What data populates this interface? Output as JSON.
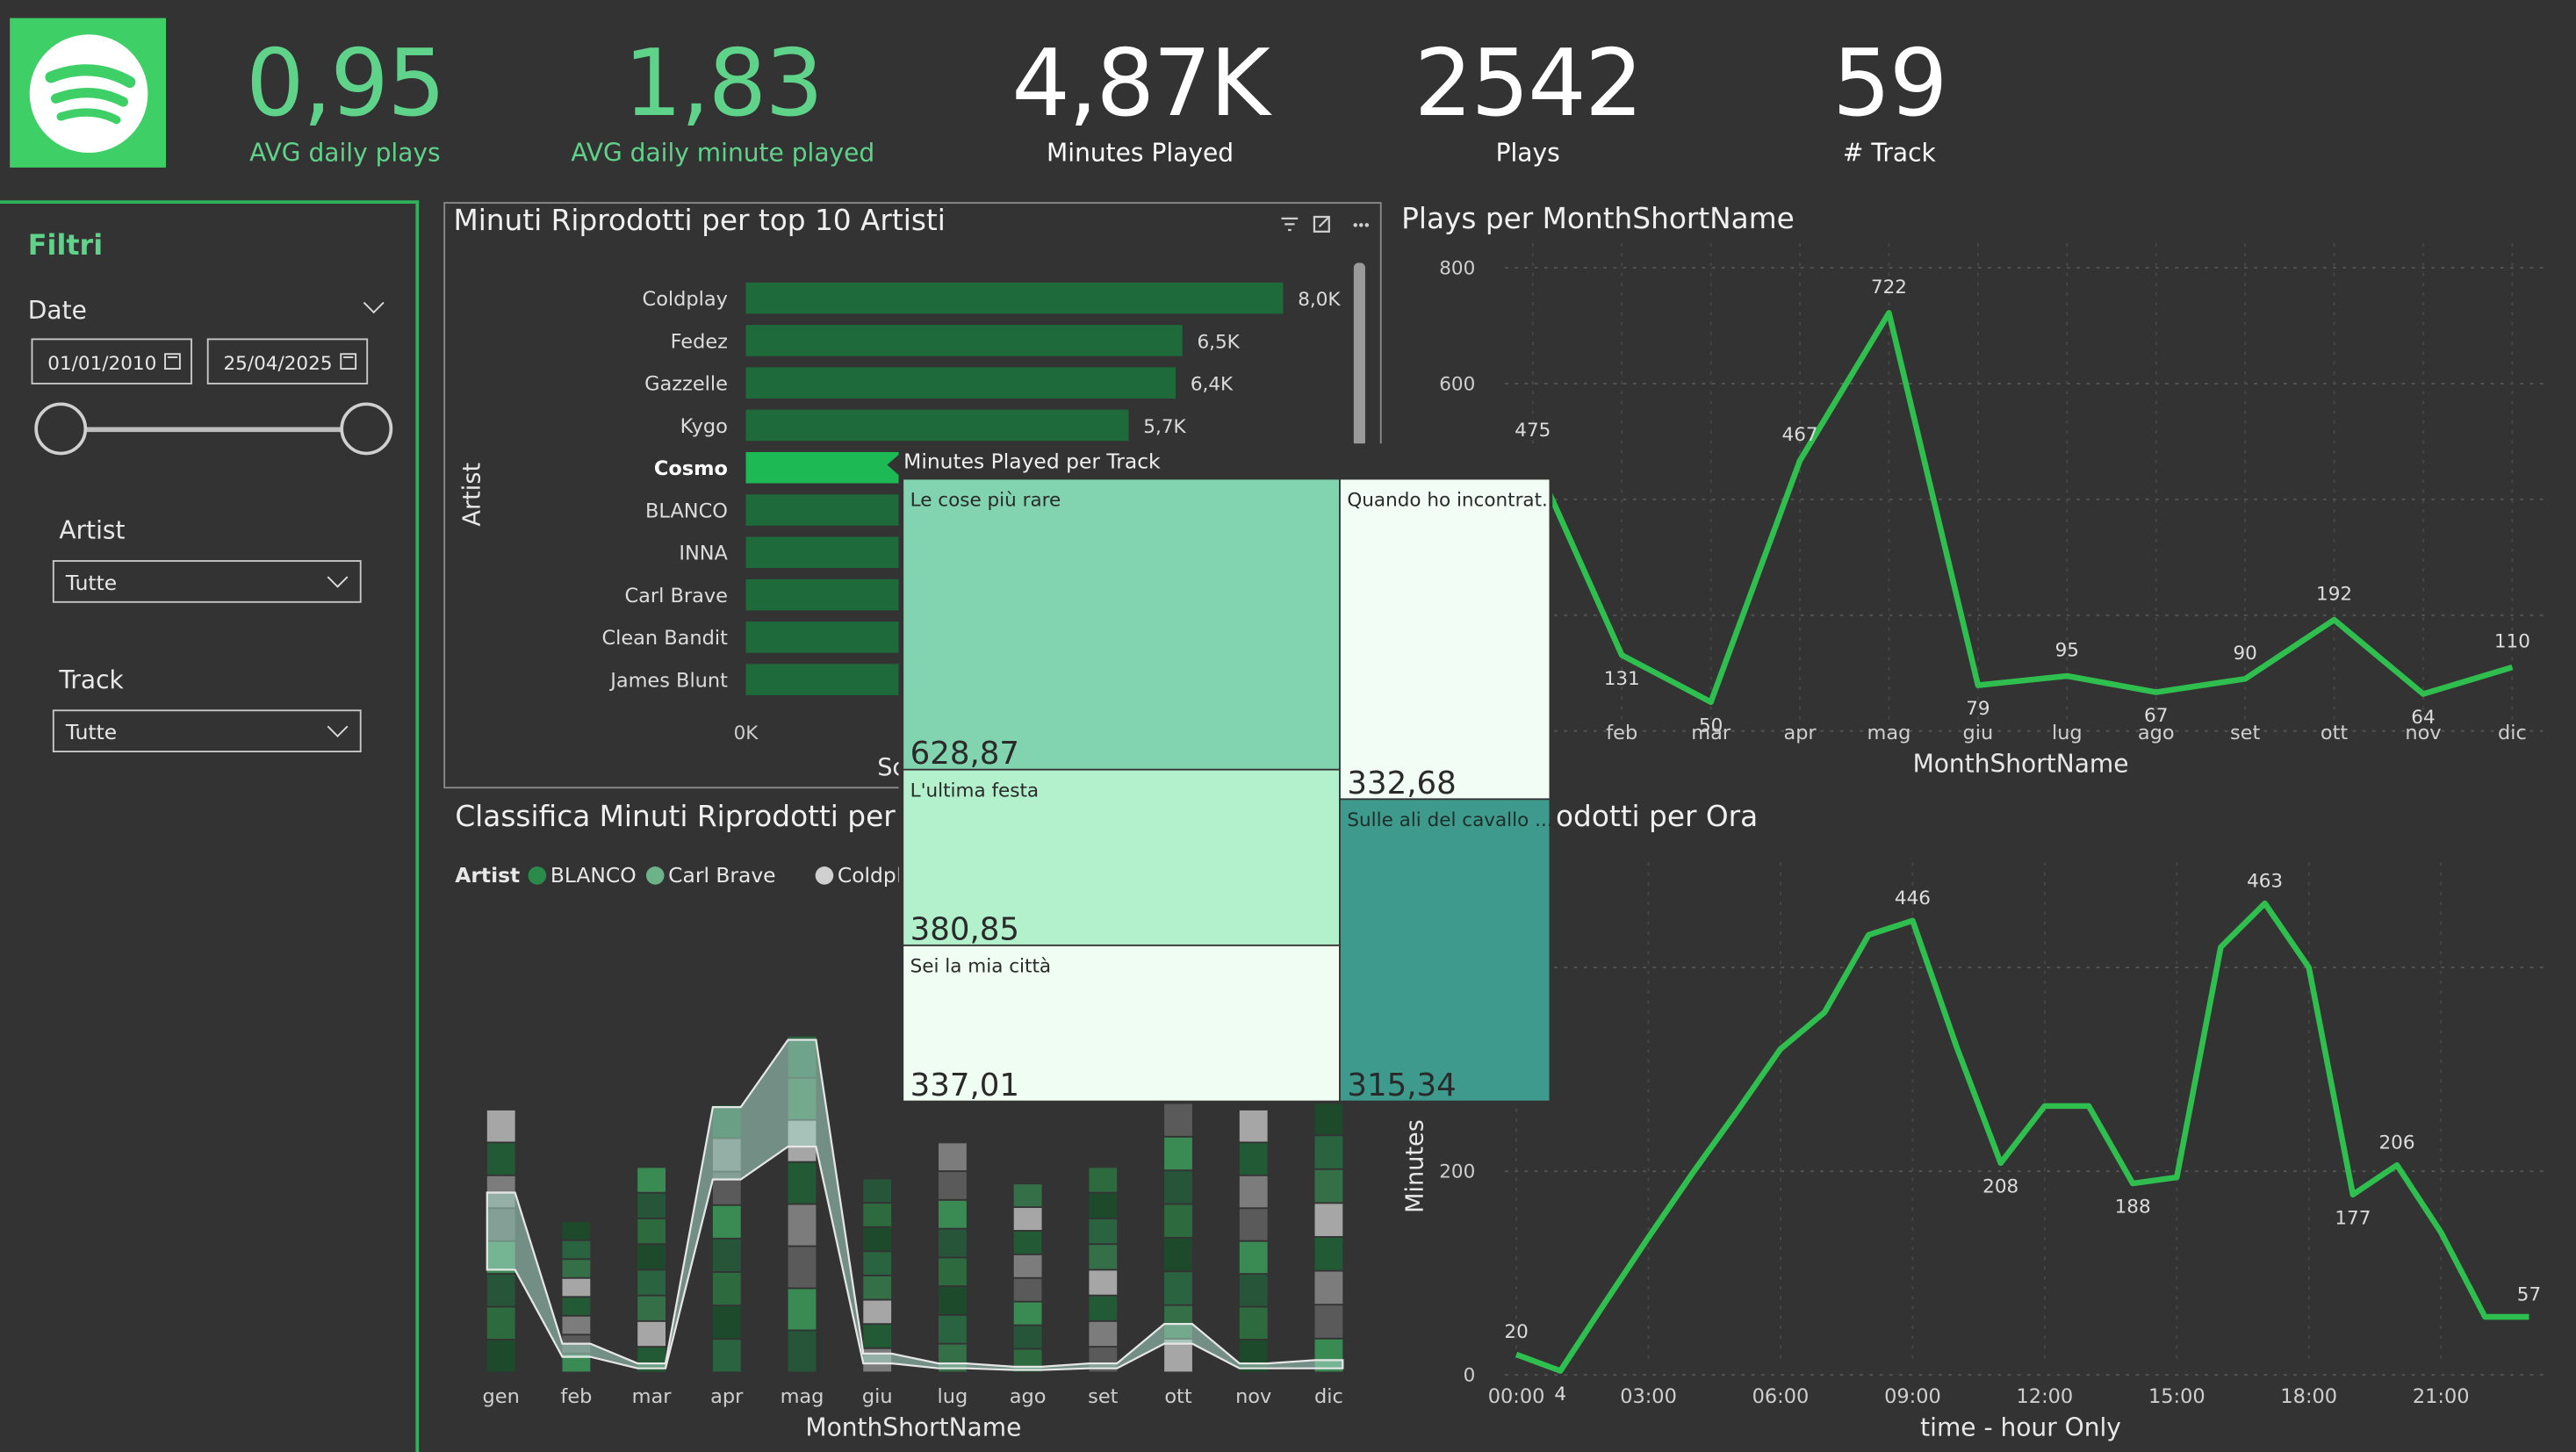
{
  "kpis": [
    {
      "value": "0,95",
      "label": "AVG daily plays"
    },
    {
      "value": "1,83",
      "label": "AVG daily minute played"
    },
    {
      "value": "4,87K",
      "label": "Minutes Played"
    },
    {
      "value": "2542",
      "label": "Plays"
    },
    {
      "value": "59",
      "label": "# Track"
    }
  ],
  "sidebar": {
    "title": "Filtri",
    "date_label": "Date",
    "date_from": "01/01/2010",
    "date_to": "25/04/2025",
    "date_range_fraction": [
      0,
      1
    ],
    "artist_label": "Artist",
    "artist_value": "Tutte",
    "track_label": "Track",
    "track_value": "Tutte"
  },
  "icons": {
    "logo": "spotify-logo",
    "filter": "filter-icon",
    "focus": "focus-mode-icon",
    "more": "more-options-icon",
    "calendar": "calendar-icon",
    "dropdown": "chevron-down-icon"
  },
  "colors": {
    "accent": "#2fb35a",
    "line": "#2fbf4f",
    "bar": "#1e6a3a",
    "bar_highlight": "#1db954",
    "background": "#333333"
  },
  "panels": {
    "bar_title": "Minuti Riprodotti per top 10 Artisti",
    "line_title": "Plays per MonthShortName",
    "ribbon_title": "Classifica Minuti Riprodotti per",
    "hour_title": "odotti per Ora",
    "tooltip_title": "Minutes Played per Track"
  },
  "chart_data": [
    {
      "type": "bar",
      "orientation": "horizontal",
      "title": "Minuti Riprodotti per top 10 Artisti",
      "ylabel": "Artist",
      "xlabel": "Sc",
      "x_tick": "0K",
      "categories": [
        "Coldplay",
        "Fedez",
        "Gazzelle",
        "Kygo",
        "Cosmo",
        "BLANCO",
        "INNA",
        "Carl Brave",
        "Clean Bandit",
        "James Blunt"
      ],
      "values": [
        8000,
        6500,
        6400,
        5700,
        5000,
        4600,
        4200,
        3900,
        3700,
        3500
      ],
      "data_labels": [
        "8,0K",
        "6,5K",
        "6,4K",
        "5,7K",
        "",
        "",
        "",
        "",
        "",
        ""
      ],
      "highlighted": "Cosmo"
    },
    {
      "type": "line",
      "title": "Plays per MonthShortName",
      "xlabel": "MonthShortName",
      "categories": [
        "gen",
        "feb",
        "mar",
        "apr",
        "mag",
        "giu",
        "lug",
        "ago",
        "set",
        "ott",
        "nov",
        "dic"
      ],
      "visible_x_labels": [
        "feb",
        "mar",
        "apr",
        "mag",
        "giu",
        "lug",
        "ago",
        "set",
        "ott",
        "nov",
        "dic"
      ],
      "values": [
        475,
        131,
        50,
        467,
        722,
        79,
        95,
        67,
        90,
        192,
        64,
        110
      ],
      "data_labels": [
        "475",
        "131",
        "50",
        "467",
        "722",
        "79",
        "95",
        "67",
        "90",
        "192",
        "64",
        "110"
      ],
      "ylim": [
        0,
        800
      ],
      "y_ticks": [
        "800",
        "600"
      ],
      "grid": true
    },
    {
      "type": "bar",
      "stacked": true,
      "ribbon": true,
      "title": "Classifica Minuti Riprodotti per",
      "xlabel": "MonthShortName",
      "legend_title": "Artist",
      "legend": [
        "BLANCO",
        "Carl Brave",
        "Coldplay"
      ],
      "legend_colors": [
        "#2a8a4a",
        "#6cb38a",
        "#d0d0d0"
      ],
      "categories": [
        "gen",
        "feb",
        "mar",
        "apr",
        "mag",
        "giu",
        "lug",
        "ago",
        "set",
        "ott",
        "nov",
        "dic"
      ],
      "totals": [
        160,
        92,
        125,
        163,
        205,
        118,
        140,
        115,
        125,
        164,
        160,
        165
      ]
    },
    {
      "type": "line",
      "title": "odotti per Ora",
      "xlabel": "time - hour Only",
      "ylabel": "Minutes",
      "x": [
        0,
        1,
        2,
        3,
        4,
        5,
        6,
        7,
        8,
        9,
        10,
        11,
        12,
        13,
        14,
        15,
        16,
        17,
        18,
        19,
        20,
        21,
        22,
        23
      ],
      "x_tick_labels": [
        "00:00",
        "03:00",
        "06:00",
        "09:00",
        "12:00",
        "15:00",
        "18:00",
        "21:00"
      ],
      "values": [
        20,
        4,
        70,
        135,
        198,
        258,
        320,
        356,
        432,
        446,
        322,
        208,
        264,
        264,
        188,
        194,
        420,
        463,
        400,
        177,
        206,
        140,
        57,
        57
      ],
      "data_labels": {
        "0": "20",
        "1": "4",
        "9": "446",
        "11": "208",
        "14": "188",
        "17": "463",
        "19": "177",
        "20": "206",
        "23": "57"
      },
      "y_ticks": [
        "0",
        "200"
      ],
      "grid": true
    },
    {
      "type": "treemap",
      "title": "Minutes Played per Track",
      "items": [
        {
          "name": "Le cose più rare",
          "value": "628,87",
          "color": "#82d4b0"
        },
        {
          "name": "L'ultima festa",
          "value": "380,85",
          "color": "#b3f0cc"
        },
        {
          "name": "Sei la mia città",
          "value": "337,01",
          "color": "#effdf3"
        },
        {
          "name": "Quando ho incontrat...",
          "value": "332,68",
          "color": "#f2fdf5"
        },
        {
          "name": "Sulle ali del cavallo ...",
          "value": "315,34",
          "color": "#3d9a8c"
        }
      ]
    }
  ]
}
